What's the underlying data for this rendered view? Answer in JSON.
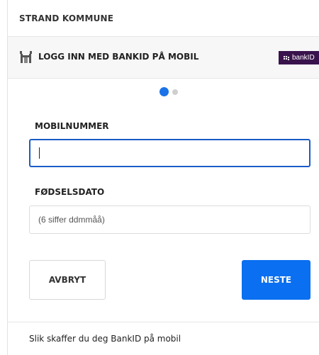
{
  "organization": {
    "name": "STRAND KOMMUNE"
  },
  "login_method": {
    "title": "LOGG INN MED BANKID PÅ MOBIL",
    "logo_text": "bankID",
    "logo_color": "#39134c",
    "icon": "castle-icon"
  },
  "stepper": {
    "current_step": 1,
    "total_steps": 2
  },
  "form": {
    "phone": {
      "label": "MOBILNUMMER",
      "value": "",
      "placeholder": ""
    },
    "birthdate": {
      "label": "FØDSELSDATO",
      "value": "",
      "placeholder": "(6 siffer ddmmåå)"
    }
  },
  "buttons": {
    "cancel_label": "AVBRYT",
    "next_label": "NESTE",
    "next_color": "#0a6ff0"
  },
  "footer": {
    "help_link": "Slik skaffer du deg BankID på mobil"
  }
}
